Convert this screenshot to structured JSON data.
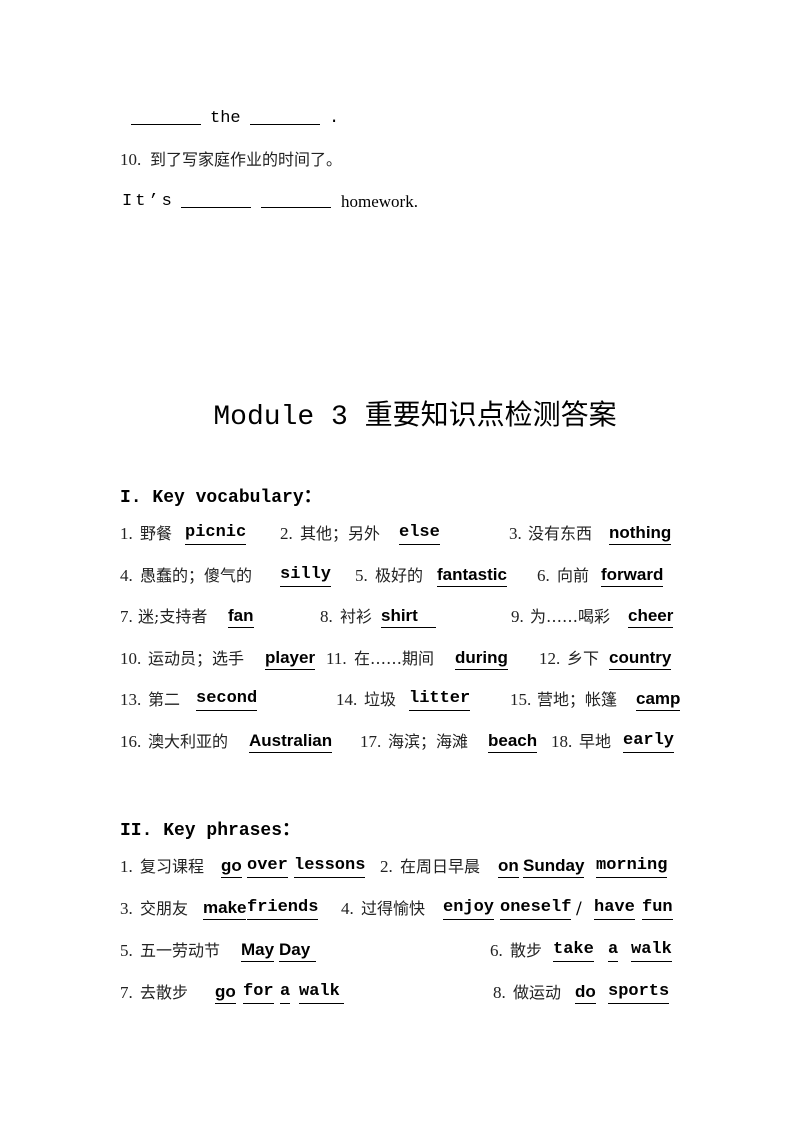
{
  "exercise_tail": {
    "line9_mid": "the",
    "line9_end": ".",
    "q10_num": "10.",
    "q10_zh": "到了写家庭作业的时间了。",
    "q10_en_start": "It’s",
    "q10_en_end": "homework."
  },
  "title": "Module 3 重要知识点检测答案",
  "vocab": {
    "heading": "I. Key vocabulary：",
    "items": [
      {
        "num": "1.",
        "zh": "野餐",
        "en": "picnic"
      },
      {
        "num": "2.",
        "zh": "其他；另外",
        "en": "else"
      },
      {
        "num": "3.",
        "zh": "没有东西",
        "en": "nothing"
      },
      {
        "num": "4.",
        "zh": "愚蠢的；傻气的",
        "en": "silly"
      },
      {
        "num": "5.",
        "zh": "极好的",
        "en": "fantastic"
      },
      {
        "num": "6.",
        "zh": "向前",
        "en": "forward"
      },
      {
        "num": "7.",
        "zh": "迷;支持者",
        "en": "fan"
      },
      {
        "num": "8.",
        "zh": "衬衫",
        "en": "shirt"
      },
      {
        "num": "9.",
        "zh": "为……喝彩",
        "en": "cheer"
      },
      {
        "num": "10.",
        "zh": "运动员；选手",
        "en": "player"
      },
      {
        "num": "11.",
        "zh": "在……期间",
        "en": "during"
      },
      {
        "num": "12.",
        "zh": "乡下",
        "en": "country"
      },
      {
        "num": "13.",
        "zh": "第二",
        "en": "second"
      },
      {
        "num": "14.",
        "zh": "垃圾",
        "en": "litter"
      },
      {
        "num": "15.",
        "zh": "营地；帐篷",
        "en": "camp"
      },
      {
        "num": "16.",
        "zh": "澳大利亚的",
        "en": "Australian"
      },
      {
        "num": "17.",
        "zh": "海滨；海滩",
        "en": "beach"
      },
      {
        "num": "18.",
        "zh": "早地",
        "en": "early"
      }
    ]
  },
  "phrases": {
    "heading": "II. Key phrases：",
    "items": [
      {
        "num": "1.",
        "zh": "复习课程",
        "words": [
          "go",
          "over",
          "lessons"
        ]
      },
      {
        "num": "2.",
        "zh": "在周日早晨",
        "words": [
          "on",
          "Sunday",
          "morning"
        ]
      },
      {
        "num": "3.",
        "zh": "交朋友",
        "words": [
          "make",
          "friends"
        ]
      },
      {
        "num": "4.",
        "zh": "过得愉快",
        "words": [
          "enjoy",
          "oneself",
          "have",
          "fun"
        ],
        "separator": "/"
      },
      {
        "num": "5.",
        "zh": "五一劳动节",
        "words": [
          "May",
          "Day"
        ]
      },
      {
        "num": "6.",
        "zh": "散步",
        "words": [
          "take",
          "a",
          "walk"
        ]
      },
      {
        "num": "7.",
        "zh": "去散步",
        "words": [
          "go",
          "for",
          "a",
          "walk"
        ]
      },
      {
        "num": "8.",
        "zh": "做运动",
        "words": [
          "do",
          "sports"
        ]
      }
    ]
  }
}
